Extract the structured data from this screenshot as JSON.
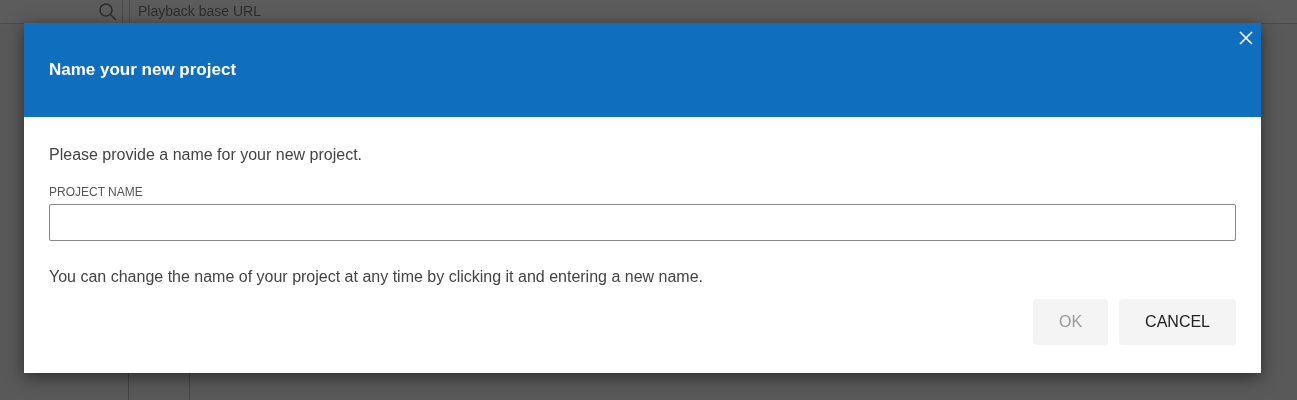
{
  "background": {
    "search_field": {
      "placeholder": "Playback base URL"
    }
  },
  "dialog": {
    "title": "Name your new project",
    "intro": "Please provide a name for your new project.",
    "field": {
      "label": "PROJECT NAME"
    },
    "hint": "You can change the name of your project at any time by clicking it and entering a new name.",
    "buttons": [
      {
        "label": "OK",
        "disabled": true
      },
      {
        "label": "CANCEL",
        "disabled": false
      }
    ]
  }
}
